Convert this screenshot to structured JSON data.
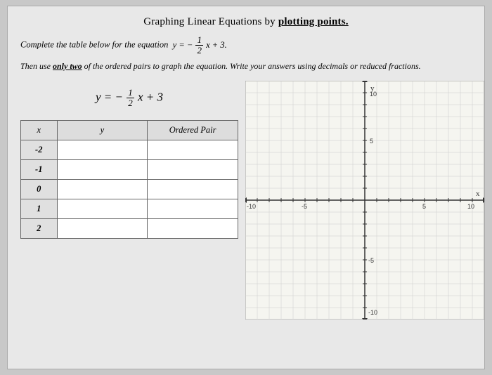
{
  "title": {
    "main": "Graphing Linear Equations by plotting points.",
    "bold_part": "plotting points."
  },
  "instructions": {
    "text": "Complete the table below for the equation",
    "equation": "y = − (1/2)x + 3"
  },
  "followup": {
    "text1": "Then use",
    "bold": "only two",
    "text2": "of the ordered pairs to graph the equation. Write your answers using decimals or reduced fractions."
  },
  "equation_display": "y = − (1/2)x + 3",
  "table": {
    "headers": [
      "x",
      "y",
      "Ordered Pair"
    ],
    "rows": [
      {
        "x": "-2",
        "y": "",
        "pair": ""
      },
      {
        "x": "-1",
        "y": "",
        "pair": ""
      },
      {
        "x": "0",
        "y": "",
        "pair": ""
      },
      {
        "x": "1",
        "y": "",
        "pair": ""
      },
      {
        "x": "2",
        "y": "",
        "pair": ""
      }
    ]
  },
  "graph": {
    "x_label": "x",
    "y_label": "y",
    "x_min": -10,
    "x_max": 10,
    "y_min": -10,
    "y_max": 10,
    "axis_labels": {
      "top_y": "10",
      "mid_y": "5",
      "neg_y": "-5",
      "bot_y": "-10",
      "left_x": "-10",
      "left_mid_x": "-5",
      "right_mid_x": "5",
      "right_x": "10"
    }
  }
}
